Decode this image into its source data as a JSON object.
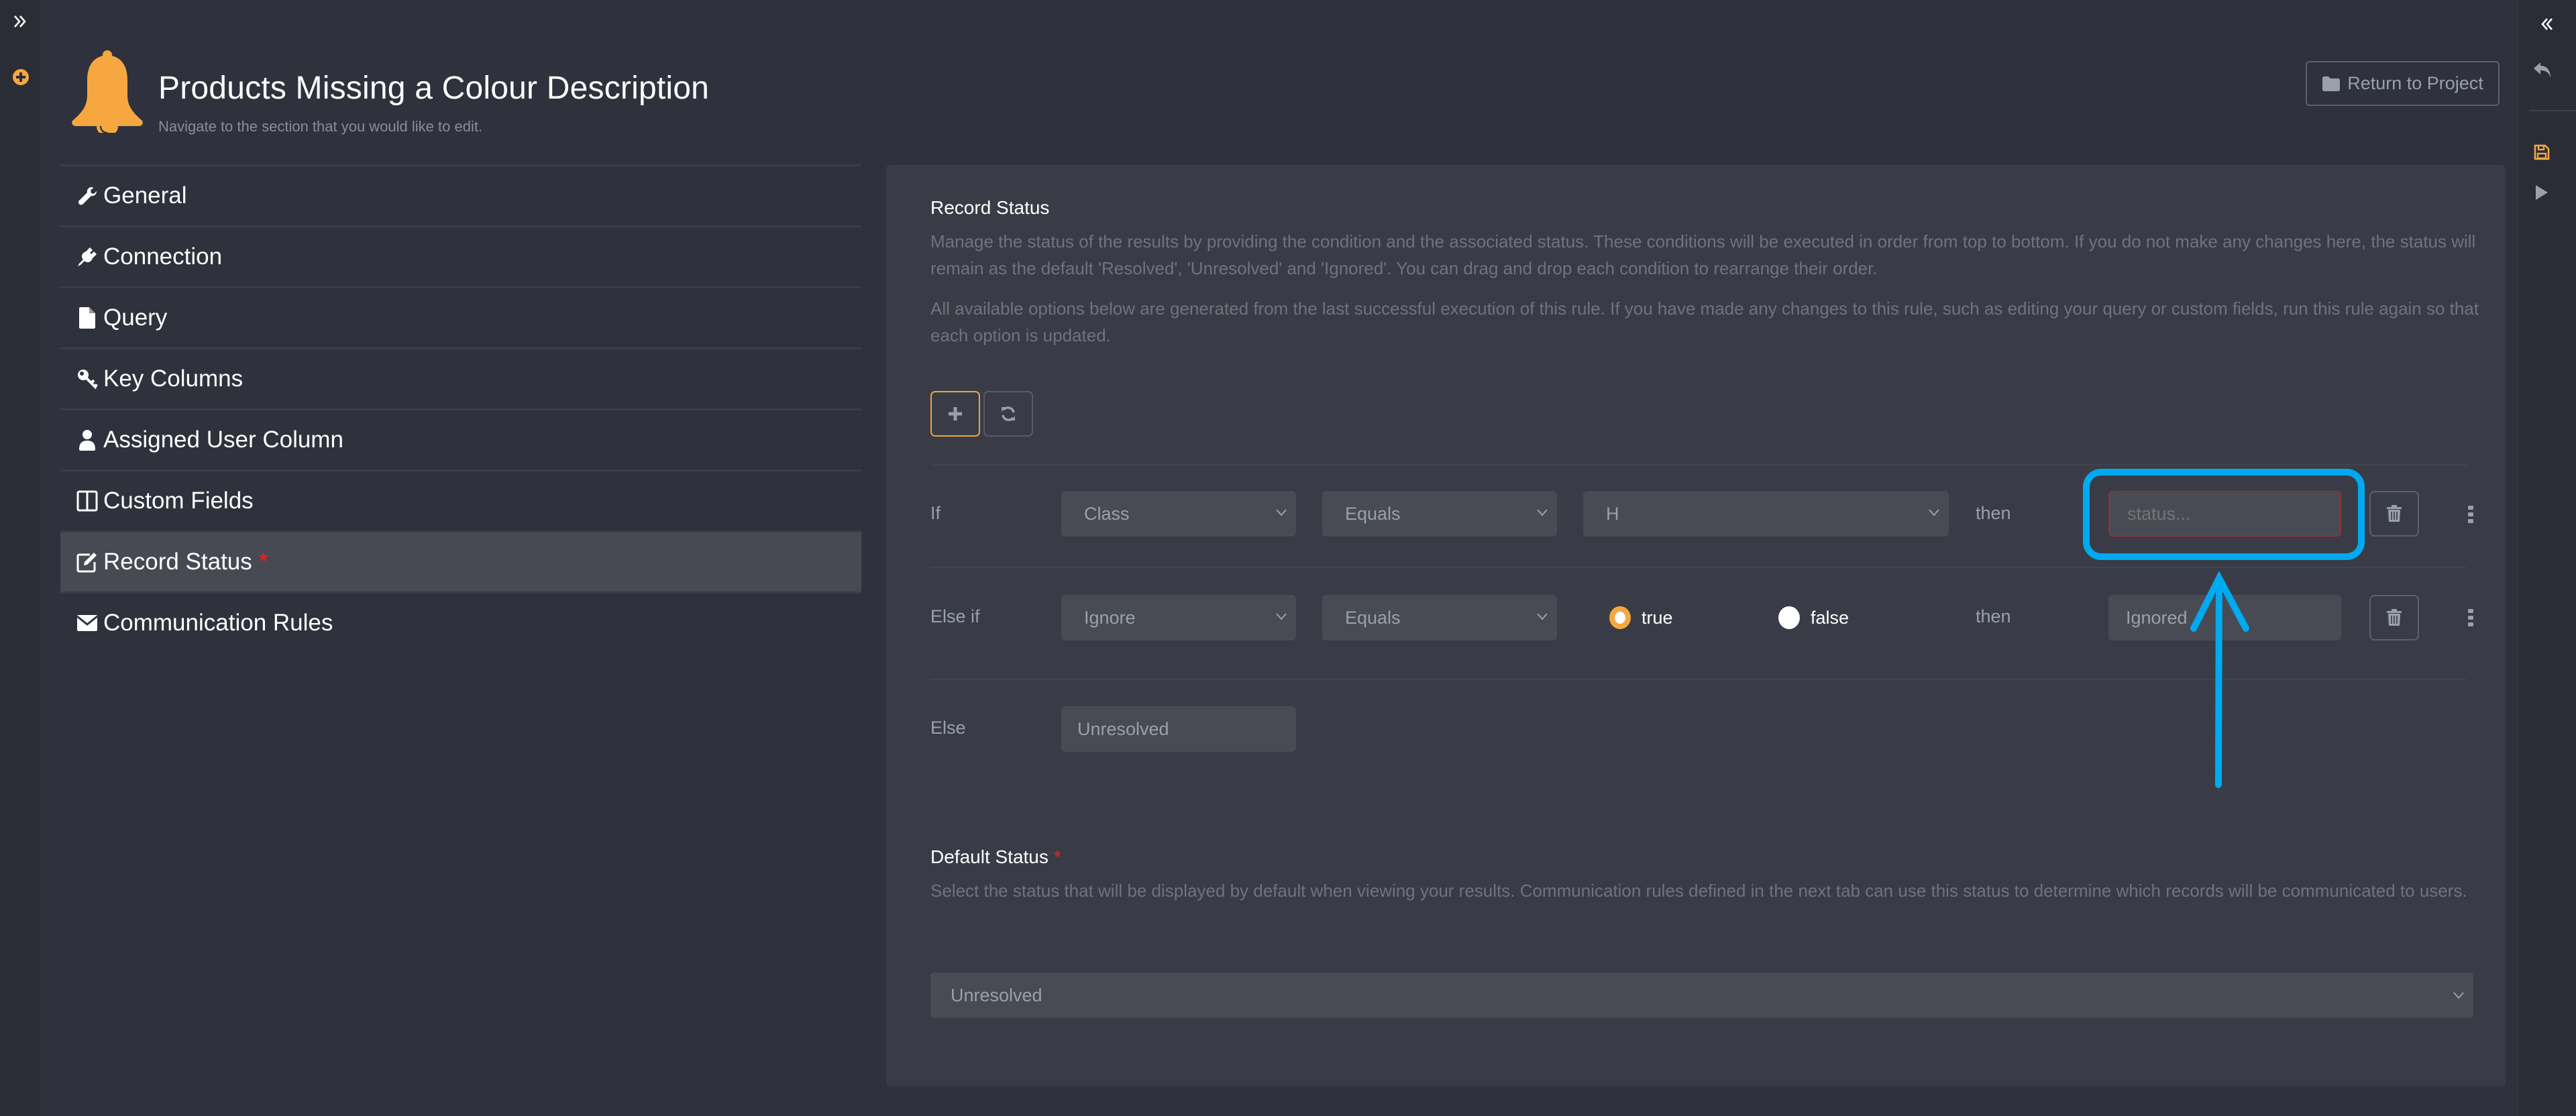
{
  "left_rail": {
    "expand_icon": "chevron-double-right-icon",
    "add_icon": "plus-circle-icon"
  },
  "right_rail": {
    "collapse_icon": "chevron-double-left-icon",
    "undo_icon": "undo-icon",
    "save_icon": "save-icon",
    "run_icon": "play-icon"
  },
  "header": {
    "icon": "bell-icon",
    "title": "Products Missing a Colour Description",
    "subtitle": "Navigate to the section that you would like to edit.",
    "return_button": "Return to Project"
  },
  "nav": {
    "items": [
      {
        "label": "General",
        "icon": "wrench-icon"
      },
      {
        "label": "Connection",
        "icon": "plug-icon"
      },
      {
        "label": "Query",
        "icon": "file-icon"
      },
      {
        "label": "Key Columns",
        "icon": "key-icon"
      },
      {
        "label": "Assigned User Column",
        "icon": "user-icon"
      },
      {
        "label": "Custom Fields",
        "icon": "columns-icon"
      },
      {
        "label": "Record Status",
        "icon": "edit-icon",
        "required": "*",
        "active": true
      },
      {
        "label": "Communication Rules",
        "icon": "envelope-icon"
      }
    ]
  },
  "record_status": {
    "title": "Record Status",
    "description_1": "Manage the status of the results by providing the condition and the associated status. These conditions will be executed in order from top to bottom. If you do not make any changes here, the status will remain as the default 'Resolved', 'Unresolved' and 'Ignored'. You can drag and drop each condition to rearrange their order.",
    "description_2": "All available options below are generated from the last successful execution of this rule. If you have made any changes to this rule, such as editing your query or custom fields, run this rule again so that each option is updated.",
    "add_button_icon": "plus-icon",
    "refresh_button_icon": "refresh-icon",
    "conditions": [
      {
        "label": "If",
        "field": "Class",
        "operator": "Equals",
        "value": "H",
        "then": "then",
        "status_value": "",
        "status_placeholder": "status..."
      },
      {
        "label": "Else if",
        "field": "Ignore",
        "operator": "Equals",
        "radio_true": "true",
        "radio_false": "false",
        "selected": "true",
        "then": "then",
        "status_value": "Ignored"
      }
    ],
    "else": {
      "label": "Else",
      "value": "Unresolved"
    }
  },
  "default_status": {
    "label": "Default Status",
    "required": "*",
    "description": "Select the status that will be displayed by default when viewing your results. Communication rules defined in the next tab can use this status to determine which records will be communicated to users.",
    "selected": "Unresolved"
  },
  "colors": {
    "accent": "#f6a740",
    "annotation": "#00aaf0",
    "required": "#ff1a1a",
    "invalid_border": "#8b3535"
  }
}
